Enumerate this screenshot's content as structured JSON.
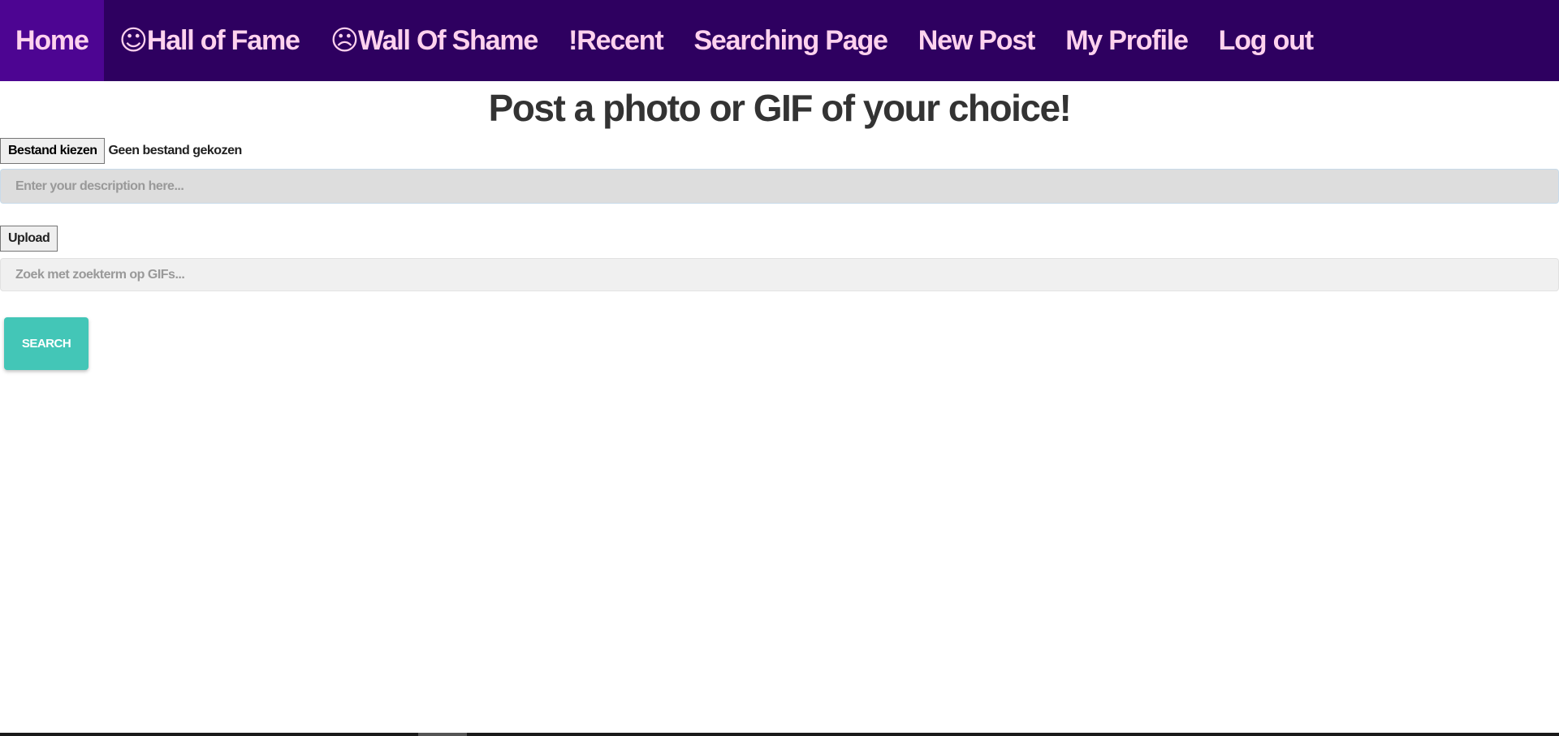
{
  "nav": {
    "items": [
      {
        "label": "Home",
        "active": true
      },
      {
        "icon": "☺",
        "label": "Hall of Fame",
        "active": false
      },
      {
        "icon": "☹",
        "label": "Wall Of Shame",
        "active": false
      },
      {
        "label": "!Recent",
        "active": false
      },
      {
        "label": "Searching Page",
        "active": false
      },
      {
        "label": "New Post",
        "active": false
      },
      {
        "label": "My Profile",
        "active": false
      },
      {
        "label": "Log out",
        "active": false
      }
    ]
  },
  "main": {
    "title": "Post a photo or GIF of your choice!",
    "file_button_label": "Bestand kiezen",
    "file_status": "Geen bestand gekozen",
    "description_placeholder": "Enter your description here...",
    "description_value": "",
    "upload_label": "Upload",
    "gif_search_placeholder": "Zoek met zoekterm op GIFs...",
    "gif_search_value": "",
    "search_label": "Search"
  },
  "colors": {
    "nav_background": "#2e0060",
    "nav_active_background": "#4d0592",
    "nav_text": "#ffd2ee",
    "title_text": "#333333",
    "search_button": "#43c6b7"
  }
}
